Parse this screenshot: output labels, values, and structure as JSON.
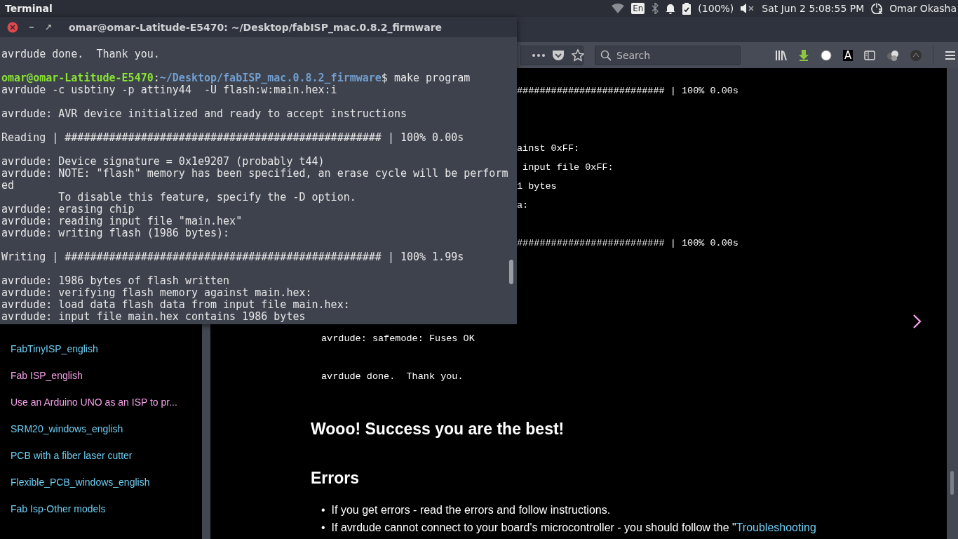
{
  "top_panel": {
    "app_name": "Terminal",
    "keyboard_layout": "En",
    "battery": "(100%)",
    "clock": "Sat Jun  2  5:08:55 PM",
    "user": "Omar Okasha"
  },
  "browser": {
    "toolbar": {
      "search": {
        "placeholder": "Search"
      },
      "extension_label": "A"
    },
    "sidebar": {
      "items": [
        {
          "label": "FabTinyISP_english",
          "color": "#6fcdf2"
        },
        {
          "label": "Fab ISP_english",
          "color": "#f3a0e6"
        },
        {
          "label": "Use an Arduino UNO as an ISP to pr...",
          "color": "#f3a0e6"
        },
        {
          "label": "SRM20_windows_english",
          "color": "#6fcdf2"
        },
        {
          "label": "PCB with a fiber laser cutter",
          "color": "#6fcdf2"
        },
        {
          "label": "Flexible_PCB_windows_english",
          "color": "#6fcdf2"
        },
        {
          "label": "Fab Isp-Other models",
          "color": "#6fcdf2"
        }
      ]
    },
    "article": [
      {
        "kind": "code",
        "clipped": true,
        "lines": [
          "########################## | 100% 0.00s"
        ]
      },
      {
        "kind": "code",
        "clipped": true,
        "lines": [
          "ainst 0xFF:",
          " input file 0xFF:",
          "1 bytes",
          "a:"
        ]
      },
      {
        "kind": "code",
        "clipped": true,
        "lines": [
          "########################## | 100% 0.00s"
        ]
      },
      {
        "kind": "code",
        "clipped": false,
        "lines": [
          "avrdude: safemode: Fuses OK"
        ]
      },
      {
        "kind": "code",
        "clipped": false,
        "lines": [
          "avrdude done.  Thank you."
        ]
      },
      {
        "kind": "heading",
        "text": "Wooo! Success you are the best!"
      },
      {
        "kind": "heading",
        "text": "Errors"
      },
      {
        "kind": "list",
        "items": [
          {
            "bullet": "•",
            "text": "If you get errors - read the errors and follow instructions."
          },
          {
            "bullet": "•",
            "text": "If avrdude cannot connect to your board's microcontroller - you should follow the \"",
            "link": "Troubleshooting"
          }
        ]
      }
    ]
  },
  "terminal": {
    "title": "omar@omar-Latitude-E5470: ~/Desktop/fabISP_mac.0.8.2_firmware",
    "lines": [
      {
        "kind": "output",
        "text": "avrdude done.  Thank you."
      },
      {
        "kind": "blank"
      },
      {
        "kind": "prompt",
        "user": "omar@omar-Latitude-E5470",
        "separator": ":",
        "path": "~/Desktop/fabISP_mac.0.8.2_firmware",
        "command": "$ make program"
      },
      {
        "kind": "output",
        "text": "avrdude -c usbtiny -p attiny44  -U flash:w:main.hex:i"
      },
      {
        "kind": "blank"
      },
      {
        "kind": "output",
        "text": "avrdude: AVR device initialized and ready to accept instructions"
      },
      {
        "kind": "blank"
      },
      {
        "kind": "output",
        "text": "Reading | ################################################## | 100% 0.00s"
      },
      {
        "kind": "blank"
      },
      {
        "kind": "output",
        "text": "avrdude: Device signature = 0x1e9207 (probably t44)"
      },
      {
        "kind": "output",
        "text": "avrdude: NOTE: \"flash\" memory has been specified, an erase cycle will be perform"
      },
      {
        "kind": "output",
        "text": "ed"
      },
      {
        "kind": "output",
        "text": "         To disable this feature, specify the -D option."
      },
      {
        "kind": "output",
        "text": "avrdude: erasing chip"
      },
      {
        "kind": "output",
        "text": "avrdude: reading input file \"main.hex\""
      },
      {
        "kind": "output",
        "text": "avrdude: writing flash (1986 bytes):"
      },
      {
        "kind": "blank"
      },
      {
        "kind": "output",
        "text": "Writing | ################################################## | 100% 1.99s"
      },
      {
        "kind": "blank"
      },
      {
        "kind": "output",
        "text": "avrdude: 1986 bytes of flash written"
      },
      {
        "kind": "output",
        "text": "avrdude: verifying flash memory against main.hex:"
      },
      {
        "kind": "output",
        "text": "avrdude: load data flash data from input file main.hex:"
      },
      {
        "kind": "output",
        "text": "avrdude: input file main.hex contains 1986 bytes"
      }
    ]
  }
}
